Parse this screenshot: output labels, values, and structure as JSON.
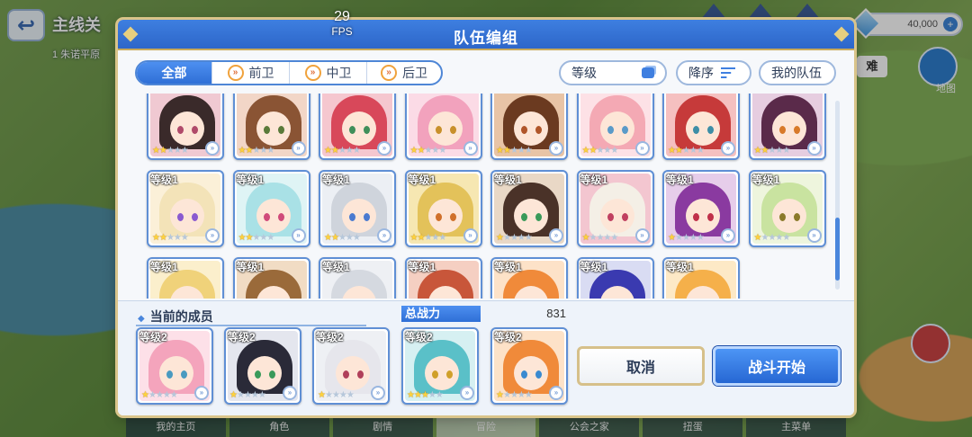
{
  "hud": {
    "back_glyph": "↩",
    "stage_title": "主线关",
    "stage_sub": "1 朱诺平原",
    "gems": "40,000",
    "gems_plus": "+",
    "badge": "难",
    "map_label": "地图"
  },
  "fps": {
    "value": "29",
    "unit": "FPS"
  },
  "dialog": {
    "title": "队伍编组",
    "filters": [
      {
        "label": "全部",
        "icon": ""
      },
      {
        "label": "前卫",
        "icon": "vanguard-icon"
      },
      {
        "label": "中卫",
        "icon": "midguard-icon"
      },
      {
        "label": "后卫",
        "icon": "rearguard-icon"
      }
    ],
    "sort_level": "等级",
    "sort_order": "降序",
    "my_team": "我的队伍"
  },
  "roster": [
    {
      "level": "",
      "stars": 2,
      "hair": "#3a2a2a",
      "eye": "#b04a6a",
      "bg": "#f0c9d2"
    },
    {
      "level": "",
      "stars": 2,
      "hair": "#8a5434",
      "eye": "#5a7a3a",
      "bg": "#f2d6c7"
    },
    {
      "level": "",
      "stars": 2,
      "hair": "#d8485a",
      "eye": "#3f8f5a",
      "bg": "#f5c7cf"
    },
    {
      "level": "",
      "stars": 2,
      "hair": "#f2a2bd",
      "eye": "#c8902a",
      "bg": "#fbdbe6"
    },
    {
      "level": "",
      "stars": 2,
      "hair": "#6b3a20",
      "eye": "#b0562a",
      "bg": "#e8c4a6"
    },
    {
      "level": "",
      "stars": 2,
      "hair": "#f4a9b4",
      "eye": "#5a9ac8",
      "bg": "#fde1e6"
    },
    {
      "level": "",
      "stars": 2,
      "hair": "#c63a3a",
      "eye": "#3e8ea6",
      "bg": "#f5c0c0"
    },
    {
      "level": "",
      "stars": 2,
      "hair": "#5a2a4a",
      "eye": "#d87a2a",
      "bg": "#e6cde0"
    },
    {
      "level": "等级1",
      "stars": 2,
      "hair": "#f3e3b8",
      "eye": "#8a5ad0",
      "bg": "#fbf0d8"
    },
    {
      "level": "等级1",
      "stars": 2,
      "hair": "#a9e1e6",
      "eye": "#d04a7a",
      "bg": "#dff4f5"
    },
    {
      "level": "等级1",
      "stars": 2,
      "hair": "#cfd4dc",
      "eye": "#4a7ad0",
      "bg": "#eceff4"
    },
    {
      "level": "等级1",
      "stars": 2,
      "hair": "#e3c25a",
      "eye": "#d0702a",
      "bg": "#f6e7b2"
    },
    {
      "level": "等级1",
      "stars": 1,
      "hair": "#4a3228",
      "eye": "#3a9a5a",
      "bg": "#e9d8c6"
    },
    {
      "level": "等级1",
      "stars": 1,
      "hair": "#f4efe6",
      "eye": "#c04060",
      "bg": "#f3c6d0"
    },
    {
      "level": "等级1",
      "stars": 1,
      "hair": "#8a3aa0",
      "eye": "#c0304a",
      "bg": "#e6cdea"
    },
    {
      "level": "等级1",
      "stars": 1,
      "hair": "#c9e3a0",
      "eye": "#8a7a2a",
      "bg": "#eef5dd"
    },
    {
      "level": "等级1",
      "stars": 1,
      "hair": "#f0d27a",
      "eye": "#7a4ad0",
      "bg": "#fbefcc"
    },
    {
      "level": "等级1",
      "stars": 1,
      "hair": "#9a6a3a",
      "eye": "#6a8a3a",
      "bg": "#f1dcc4"
    },
    {
      "level": "等级1",
      "stars": 1,
      "hair": "#d5d9e0",
      "eye": "#5a7ab0",
      "bg": "#eef0f4"
    },
    {
      "level": "等级1",
      "stars": 1,
      "hair": "#c8563a",
      "eye": "#3a8aa8",
      "bg": "#f5cfc2"
    },
    {
      "level": "等级1",
      "stars": 1,
      "hair": "#f08a3a",
      "eye": "#4a7ac0",
      "bg": "#fde2c8"
    },
    {
      "level": "等级1",
      "stars": 1,
      "hair": "#3a3ab0",
      "eye": "#c03a6a",
      "bg": "#d9dcf3"
    },
    {
      "level": "等级1",
      "stars": 1,
      "hair": "#f5b04a",
      "eye": "#3a8ad0",
      "bg": "#fde9c6"
    }
  ],
  "party": {
    "label": "当前的成员",
    "power_label": "总战力",
    "power_value": "831",
    "members": [
      {
        "level": "等级2",
        "stars": 1,
        "hair": "#f4a4bc",
        "eye": "#4a9ac0",
        "bg": "#fde0e8"
      },
      {
        "level": "等级2",
        "stars": 1,
        "hair": "#2a2a38",
        "eye": "#3a9a5a",
        "bg": "#e4e6ee"
      },
      {
        "level": "等级2",
        "stars": 1,
        "hair": "#e6e6ec",
        "eye": "#b0405a",
        "bg": "#eef0f4"
      },
      {
        "level": "等级2",
        "stars": 3,
        "hair": "#5ac0c8",
        "eye": "#d0a02a",
        "bg": "#d6f0f2"
      },
      {
        "level": "等级2",
        "stars": 1,
        "hair": "#f08a3a",
        "eye": "#3a8ad0",
        "bg": "#fde2c8"
      }
    ],
    "cancel": "取消",
    "start": "战斗开始"
  },
  "nav": [
    "我的主页",
    "角色",
    "剧情",
    "冒险",
    "公会之家",
    "扭蛋",
    "主菜单"
  ]
}
